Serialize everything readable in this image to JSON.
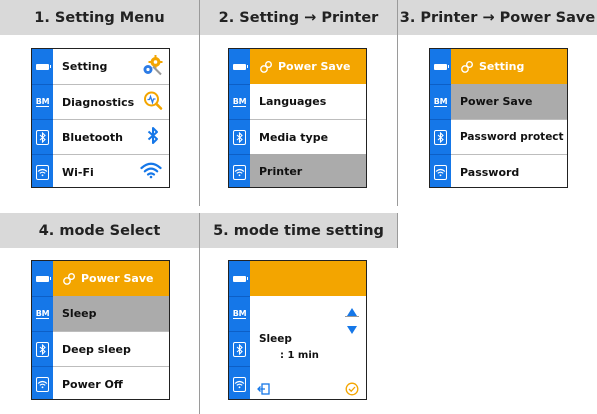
{
  "headers": {
    "step1": "1. Setting Menu",
    "step2": "2. Setting → Printer",
    "step3": "3. Printer → Power Save",
    "step4": "4. mode Select",
    "step5": "5. mode time setting"
  },
  "screen1": {
    "items": [
      "Setting",
      "Diagnostics",
      "Bluetooth",
      "Wi-Fi"
    ]
  },
  "screen2": {
    "title": "Power Save",
    "items": [
      "Languages",
      "Media type",
      "Printer"
    ],
    "selected": "Printer"
  },
  "screen3": {
    "title": "Setting",
    "items": [
      "Power Save",
      "Password protect",
      "Password"
    ],
    "selected": "Power Save"
  },
  "screen4": {
    "title": "Power Save",
    "items": [
      "Sleep",
      "Deep sleep",
      "Power Off"
    ],
    "selected": "Sleep"
  },
  "screen5": {
    "mode": "Sleep",
    "value": ": 1 min"
  },
  "rail": {
    "bm_label": "BM"
  },
  "colors": {
    "accent": "#f3a500",
    "rail": "#1577e8",
    "selected": "#ababab",
    "header": "#d9d9d9"
  }
}
